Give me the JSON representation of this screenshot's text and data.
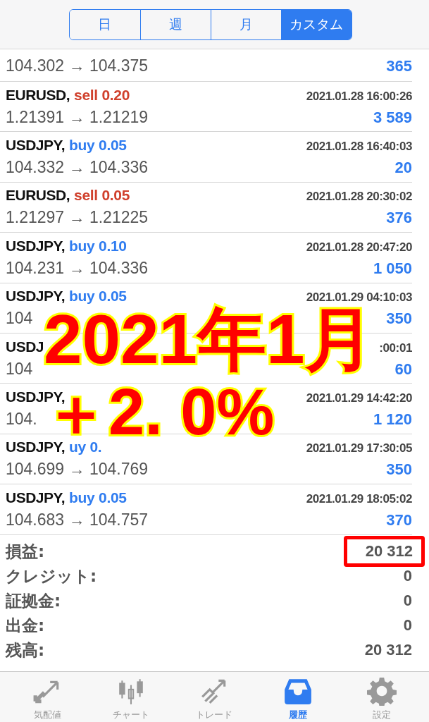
{
  "periods": [
    {
      "label": "日",
      "selected": false
    },
    {
      "label": "週",
      "selected": false
    },
    {
      "label": "月",
      "selected": false
    },
    {
      "label": "カスタム",
      "selected": true
    }
  ],
  "deals": [
    {
      "prices": [
        "104.302 → 104.375"
      ],
      "profit": "365"
    },
    {
      "symbol": "EURUSD,",
      "color": "#d0402c",
      "trade": "sell 0.20",
      "time": [
        "2021.01.28 16:00:26"
      ],
      "prices": [
        "1.21391 → 1.21219"
      ],
      "profit": "3 589"
    },
    {
      "symbol": "USDJPY,",
      "color": "#2f7cf0",
      "trade": "buy 0.05",
      "time": [
        "2021.01.28 16:40:03"
      ],
      "prices": [
        "104.332 → 104.336"
      ],
      "profit": "20"
    },
    {
      "symbol": "EURUSD,",
      "color": "#d0402c",
      "trade": "sell 0.05",
      "time": [
        "2021.01.28 20:30:02"
      ],
      "prices": [
        "1.21297 → 1.21225"
      ],
      "profit": "376"
    },
    {
      "symbol": "USDJPY,",
      "color": "#2f7cf0",
      "trade": "buy 0.10",
      "time": [
        "2021.01.28 20:47:20"
      ],
      "prices": [
        "104.231 → 104.336"
      ],
      "profit": "1 050"
    },
    {
      "symbol": "USDJPY,",
      "color": "#2f7cf0",
      "trade": "buy 0.05",
      "time": [
        "2021.01.29 04:10:03"
      ],
      "prices": [
        "104"
      ],
      "profit": "350"
    },
    {
      "symbol": "USDJ",
      "time": [
        ":00:01"
      ],
      "prices": [
        "104"
      ],
      "profit": "60"
    },
    {
      "symbol": "USDJPY,",
      "time": [
        "2021.01.29 14:42:20"
      ],
      "prices": [
        "104."
      ],
      "profit": "1 120"
    },
    {
      "symbol": "USDJPY,",
      "color": "#2f7cf0",
      "trade": "uy 0.",
      "time": [
        "2021.01.29 17:30:05"
      ],
      "prices": [
        "104.699 → 104.769"
      ],
      "profit": "350"
    },
    {
      "symbol": "USDJPY,",
      "color": "#2f7cf0",
      "trade": "buy 0.05",
      "time": [
        "2021.01.29 18:05:02"
      ],
      "prices": [
        "104.683 → 104.757"
      ],
      "profit": "370"
    }
  ],
  "summary": [
    {
      "label": "損益:",
      "value": "20 312",
      "highlighted": true
    },
    {
      "label": "クレジット:",
      "value": "0",
      "highlighted": false
    },
    {
      "label": "証拠金:",
      "value": "0",
      "highlighted": false
    },
    {
      "label": "出金:",
      "value": "0",
      "highlighted": false
    },
    {
      "label": "残高:",
      "value": "20 312",
      "highlighted": false
    }
  ],
  "overlay": {
    "lines": [
      "2021年1月",
      "＋2. 0%"
    ]
  },
  "tab_bar": [
    {
      "label": "気配値",
      "kind": "quotes",
      "selected": false
    },
    {
      "label": "チャート",
      "kind": "chart",
      "selected": false
    },
    {
      "label": "トレード",
      "kind": "trade",
      "selected": false
    },
    {
      "label": "履歴",
      "kind": "history",
      "selected": true
    },
    {
      "label": "設定",
      "kind": "settings",
      "selected": false
    }
  ]
}
